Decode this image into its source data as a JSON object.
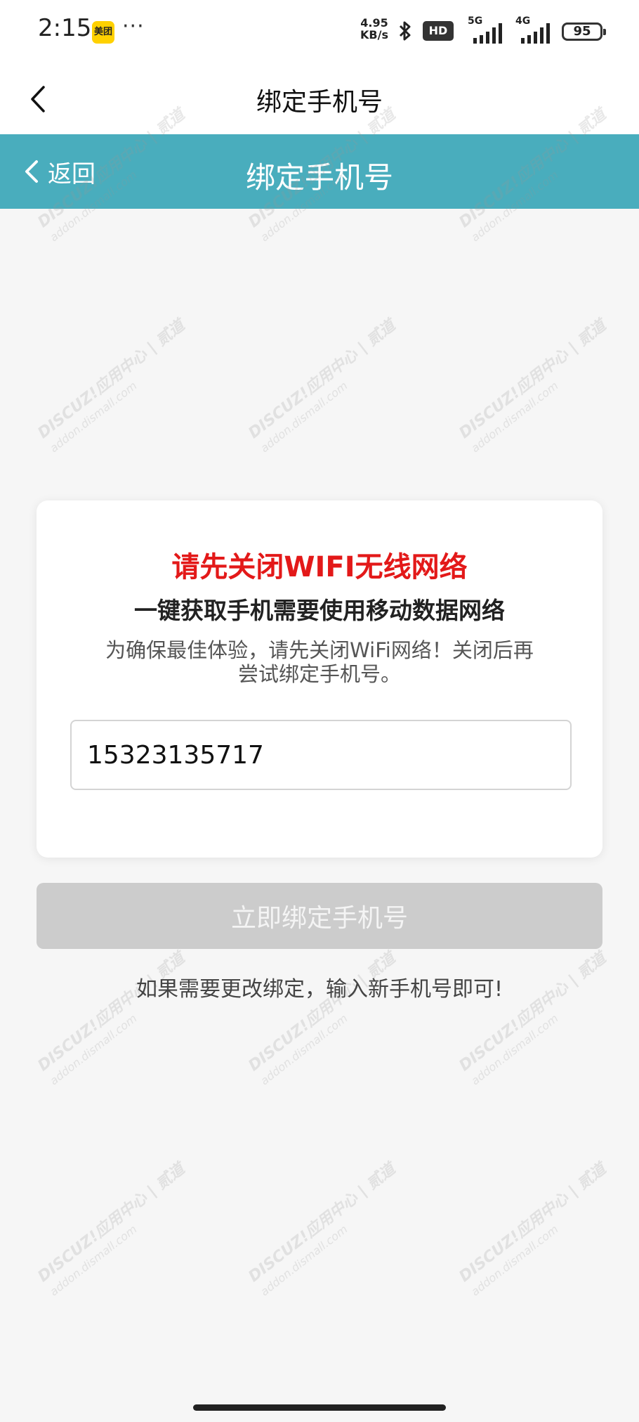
{
  "status_bar": {
    "time": "2:15",
    "meituan_badge": "美团",
    "dots": "···",
    "net_speed_value": "4.95",
    "net_speed_unit": "KB/s",
    "hd_label": "HD",
    "sig5g_label": "5G",
    "sig4g_label": "4G",
    "battery": "95"
  },
  "native_header": {
    "title": "绑定手机号"
  },
  "page_header": {
    "back_label": "返回",
    "title": "绑定手机号",
    "color": "#49adbd"
  },
  "card": {
    "warning_title": "请先关闭WIFI无线网络",
    "subtitle": "一键获取手机需要使用移动数据网络",
    "description_line1": "为确保最佳体验，请先关闭WiFi网络！关闭后再",
    "description_line2": "尝试绑定手机号。",
    "phone_value": "15323135717"
  },
  "bind_button": {
    "label": "立即绑定手机号"
  },
  "hint": "如果需要更改绑定，输入新手机号即可!",
  "colors": {
    "warning": "#e31919",
    "disabled_button": "#cccccc"
  },
  "watermark": {
    "brand": "DISCUZ!应用中心 | 贰道",
    "url": "addon.dismall.com"
  }
}
